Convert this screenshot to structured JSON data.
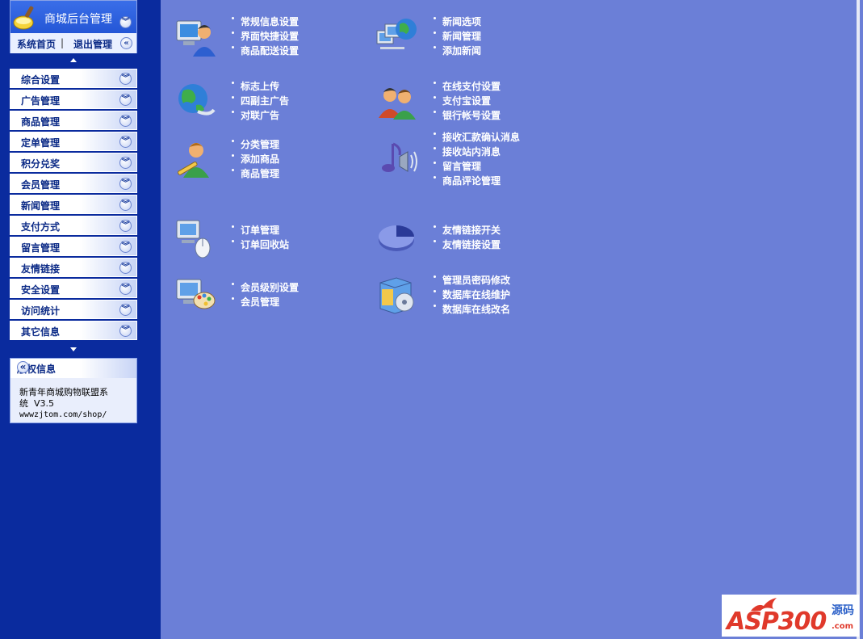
{
  "sidebar": {
    "title": "商城后台管理",
    "home_link": "系统首页",
    "separator": "|",
    "logout_link": "退出管理",
    "menu": [
      {
        "label": "综合设置",
        "name": "general-settings"
      },
      {
        "label": "广告管理",
        "name": "ad-management"
      },
      {
        "label": "商品管理",
        "name": "product-management"
      },
      {
        "label": "定单管理",
        "name": "order-management"
      },
      {
        "label": "积分兑奖",
        "name": "points-redeem"
      },
      {
        "label": "会员管理",
        "name": "member-management"
      },
      {
        "label": "新闻管理",
        "name": "news-management"
      },
      {
        "label": "支付方式",
        "name": "payment-methods"
      },
      {
        "label": "留言管理",
        "name": "message-management"
      },
      {
        "label": "友情链接",
        "name": "friend-links"
      },
      {
        "label": "安全设置",
        "name": "security-settings"
      },
      {
        "label": "访问统计",
        "name": "visit-stats"
      },
      {
        "label": "其它信息",
        "name": "other-info"
      }
    ],
    "copyright": {
      "title": "版权信息",
      "line1": "新青年商城购物联盟系",
      "line2": "统  V3.5",
      "url": "wwwzjtom.com/shop/"
    }
  },
  "main": {
    "groups": [
      {
        "icon": "computer-user-icon",
        "items": [
          "常规信息设置",
          "界面快捷设置",
          "商品配送设置"
        ]
      },
      {
        "icon": "network-globe-icon",
        "items": [
          "新闻选项",
          "新闻管理",
          "添加新闻"
        ]
      },
      {
        "icon": "globe-icon",
        "items": [
          "标志上传",
          "四副主广告",
          "对联广告"
        ]
      },
      {
        "icon": "users-icon",
        "items": [
          "在线支付设置",
          "支付宝设置",
          "银行帐号设置"
        ]
      },
      {
        "icon": "user-edit-icon",
        "items": [
          "分类管理",
          "添加商品",
          "商品管理"
        ]
      },
      {
        "icon": "speaker-icon",
        "items": [
          "接收汇款确认消息",
          "接收站内消息",
          "留言管理",
          "商品评论管理"
        ]
      },
      {
        "icon": "computer-mouse-icon",
        "items": [
          "订单管理",
          "订单回收站"
        ]
      },
      {
        "icon": "pie-chart-icon",
        "items": [
          "友情链接开关",
          "友情链接设置"
        ]
      },
      {
        "icon": "display-palette-icon",
        "items": [
          "会员级别设置",
          "会员管理"
        ]
      },
      {
        "icon": "software-box-icon",
        "items": [
          "管理员密码修改",
          "数据库在线维护",
          "数据库在线改名"
        ]
      }
    ]
  },
  "watermark": {
    "main": "ASP300",
    "side": "源码",
    "suffix": ".com"
  }
}
